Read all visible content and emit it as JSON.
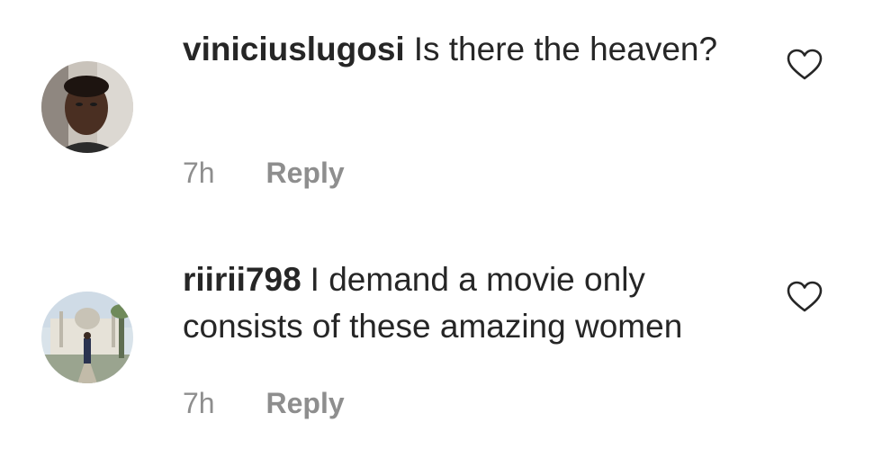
{
  "comments": [
    {
      "username": "viniciuslugosi",
      "text": "Is there the heaven?",
      "time": "7h",
      "reply_label": "Reply",
      "avatar_icon": "profile-photo-man",
      "like_icon": "heart-outline-icon"
    },
    {
      "username": "riirii798",
      "text": "I demand a movie only consists of these amazing women",
      "time": "7h",
      "reply_label": "Reply",
      "avatar_icon": "profile-photo-mosque",
      "like_icon": "heart-outline-icon"
    }
  ],
  "colors": {
    "text": "#262626",
    "secondary": "#8e8e8e",
    "background": "#ffffff"
  }
}
